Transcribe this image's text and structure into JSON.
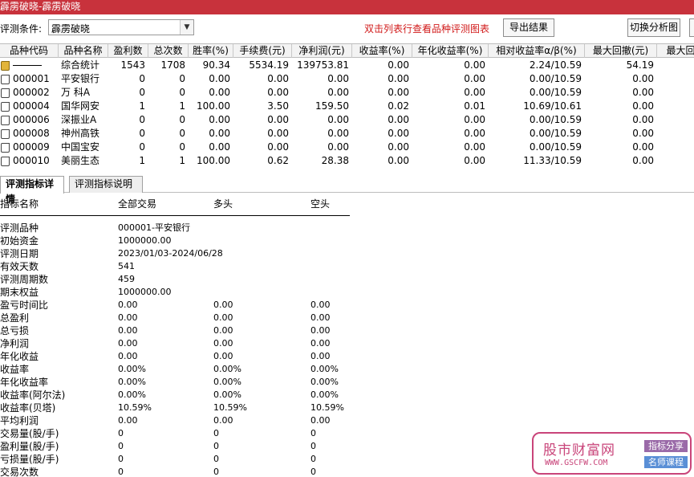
{
  "window": {
    "title": "霹雳破晓-霹雳破晓"
  },
  "toolbar": {
    "condition_label": "评测条件:",
    "condition_value": "霹雳破晓",
    "hint": "双击列表行查看品种评测图表",
    "export_label": "导出结果",
    "switch_label": "切换分析图"
  },
  "grid": {
    "headers": [
      "品种代码",
      "品种名称",
      "盈利数",
      "总次数",
      "胜率(%)",
      "手续费(元)",
      "净利润(元)",
      "收益率(%)",
      "年化收益率(%)",
      "相对收益率α/β(%)",
      "最大回撤(元)",
      "最大回"
    ],
    "summary": {
      "name": "综合统计",
      "win": "1543",
      "total": "1708",
      "rate": "90.34",
      "fee": "5534.19",
      "net": "139753.81",
      "ret": "0.00",
      "ann": "0.00",
      "rel": "2.24/10.59",
      "dd": "54.19"
    },
    "rows": [
      {
        "code": "000001",
        "name": "平安银行",
        "win": "0",
        "total": "0",
        "rate": "0.00",
        "fee": "0.00",
        "net": "0.00",
        "ret": "0.00",
        "ann": "0.00",
        "rel": "0.00/10.59",
        "dd": "0.00"
      },
      {
        "code": "000002",
        "name": "万 科A",
        "win": "0",
        "total": "0",
        "rate": "0.00",
        "fee": "0.00",
        "net": "0.00",
        "ret": "0.00",
        "ann": "0.00",
        "rel": "0.00/10.59",
        "dd": "0.00"
      },
      {
        "code": "000004",
        "name": "国华网安",
        "win": "1",
        "total": "1",
        "rate": "100.00",
        "fee": "3.50",
        "net": "159.50",
        "ret": "0.02",
        "ann": "0.01",
        "rel": "10.69/10.61",
        "dd": "0.00"
      },
      {
        "code": "000006",
        "name": "深振业A",
        "win": "0",
        "total": "0",
        "rate": "0.00",
        "fee": "0.00",
        "net": "0.00",
        "ret": "0.00",
        "ann": "0.00",
        "rel": "0.00/10.59",
        "dd": "0.00"
      },
      {
        "code": "000008",
        "name": "神州高铁",
        "win": "0",
        "total": "0",
        "rate": "0.00",
        "fee": "0.00",
        "net": "0.00",
        "ret": "0.00",
        "ann": "0.00",
        "rel": "0.00/10.59",
        "dd": "0.00"
      },
      {
        "code": "000009",
        "name": "中国宝安",
        "win": "0",
        "total": "0",
        "rate": "0.00",
        "fee": "0.00",
        "net": "0.00",
        "ret": "0.00",
        "ann": "0.00",
        "rel": "0.00/10.59",
        "dd": "0.00"
      },
      {
        "code": "000010",
        "name": "美丽生态",
        "win": "1",
        "total": "1",
        "rate": "100.00",
        "fee": "0.62",
        "net": "28.38",
        "ret": "0.00",
        "ann": "0.00",
        "rel": "11.33/10.59",
        "dd": "0.00"
      }
    ]
  },
  "tabs": [
    {
      "label": "评测指标详情",
      "active": true
    },
    {
      "label": "评测指标说明",
      "active": false
    }
  ],
  "detail": {
    "headers": [
      "指标名称",
      "全部交易",
      "多头",
      "空头"
    ],
    "rows": [
      [
        "评测品种",
        "000001-平安银行",
        "",
        ""
      ],
      [
        "初始资金",
        "1000000.00",
        "",
        ""
      ],
      [
        "评测日期",
        "2023/01/03-2024/06/28",
        "",
        ""
      ],
      [
        "有效天数",
        "541",
        "",
        ""
      ],
      [
        "评测周期数",
        "459",
        "",
        ""
      ],
      [
        "期末权益",
        "1000000.00",
        "",
        ""
      ],
      [
        "盈亏时间比",
        "0.00",
        "0.00",
        "0.00"
      ],
      [
        "总盈利",
        "0.00",
        "0.00",
        "0.00"
      ],
      [
        "总亏损",
        "0.00",
        "0.00",
        "0.00"
      ],
      [
        "净利润",
        "0.00",
        "0.00",
        "0.00"
      ],
      [
        "年化收益",
        "0.00",
        "0.00",
        "0.00"
      ],
      [
        "收益率",
        "0.00%",
        "0.00%",
        "0.00%"
      ],
      [
        "年化收益率",
        "0.00%",
        "0.00%",
        "0.00%"
      ],
      [
        "收益率(阿尔法)",
        "0.00%",
        "0.00%",
        "0.00%"
      ],
      [
        "收益率(贝塔)",
        "10.59%",
        "10.59%",
        "10.59%"
      ],
      [
        "平均利润",
        "0.00",
        "0.00",
        "0.00"
      ],
      [
        "交易量(股/手)",
        "0",
        "0",
        "0"
      ],
      [
        "盈利量(股/手)",
        "0",
        "0",
        "0"
      ],
      [
        "亏损量(股/手)",
        "0",
        "0",
        "0"
      ],
      [
        "交易次数",
        "0",
        "0",
        "0"
      ]
    ]
  },
  "watermark": {
    "name": "股市财富网",
    "url": "WWW.GSCFW.COM",
    "tag1": "指标分享",
    "tag2": "名师课程"
  },
  "colors": {
    "titlebar": "#c8323c",
    "hint": "#d11a1a",
    "watermark": "#c9457a"
  }
}
